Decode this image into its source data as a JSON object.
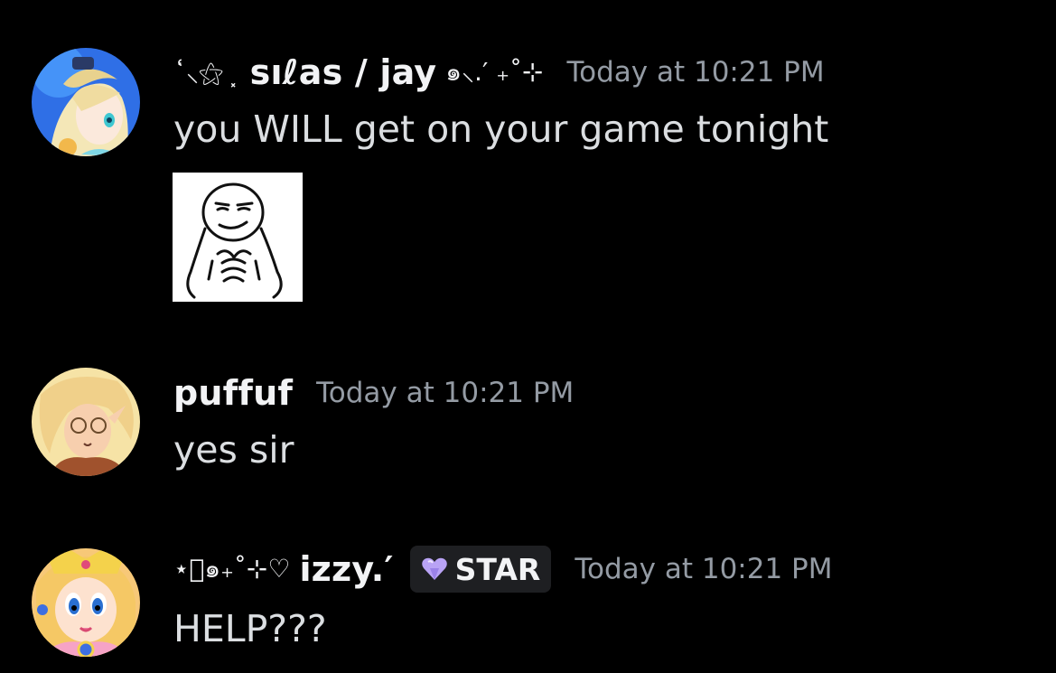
{
  "messages": [
    {
      "author_prefix": "˙͑⸜⚝ ⸼",
      "author": "sıℓas / jay",
      "author_suffix": "๑⸜.′ ₊˚⊹",
      "timestamp": "Today at 10:21 PM",
      "text": "you WILL get on your game tonight",
      "attachment": "smug-face-sticker"
    },
    {
      "author": "puffuf",
      "timestamp": "Today at 10:21 PM",
      "text": "yes sir"
    },
    {
      "author_prefix": "⋆͙๑₊˚⊹♡",
      "author": "izzy.′",
      "role_tag": "STAR",
      "timestamp": "Today at 10:21 PM",
      "text": "HELP???"
    }
  ],
  "colors": {
    "background": "#000000",
    "username": "#f2f3f5",
    "timestamp": "#949ba4",
    "message_text": "#dbdee1",
    "tag_background": "#1e1f22",
    "tag_heart": "#b9a3f5"
  },
  "icons": [
    "heart-gem-icon"
  ]
}
